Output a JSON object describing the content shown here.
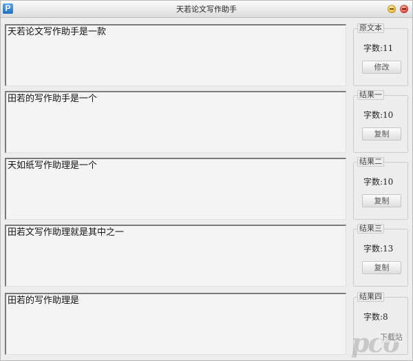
{
  "window": {
    "title": "天若论文写作助手",
    "icon_letter": "P"
  },
  "rows": [
    {
      "text": "天若论文写作助手是一款",
      "group": "原文本",
      "count": "字数:11",
      "button": "修改"
    },
    {
      "text": "田若的写作助手是一个",
      "group": "结果一",
      "count": "字数:10",
      "button": "复制"
    },
    {
      "text": "天如纸写作助理是一个",
      "group": "结果二",
      "count": "字数:10",
      "button": "复制"
    },
    {
      "text": "田若文写作助理就是其中之一",
      "group": "结果三",
      "count": "字数:13",
      "button": "复制"
    },
    {
      "text": "田若的写作助理是",
      "group": "结果四",
      "count": "字数:8",
      "button": ""
    }
  ],
  "watermark": {
    "main": "pc6",
    "sub": "下载站"
  },
  "colors": {
    "close": "#d81c10",
    "minimize": "#f0a800",
    "app_icon": "#1f6fc4"
  }
}
